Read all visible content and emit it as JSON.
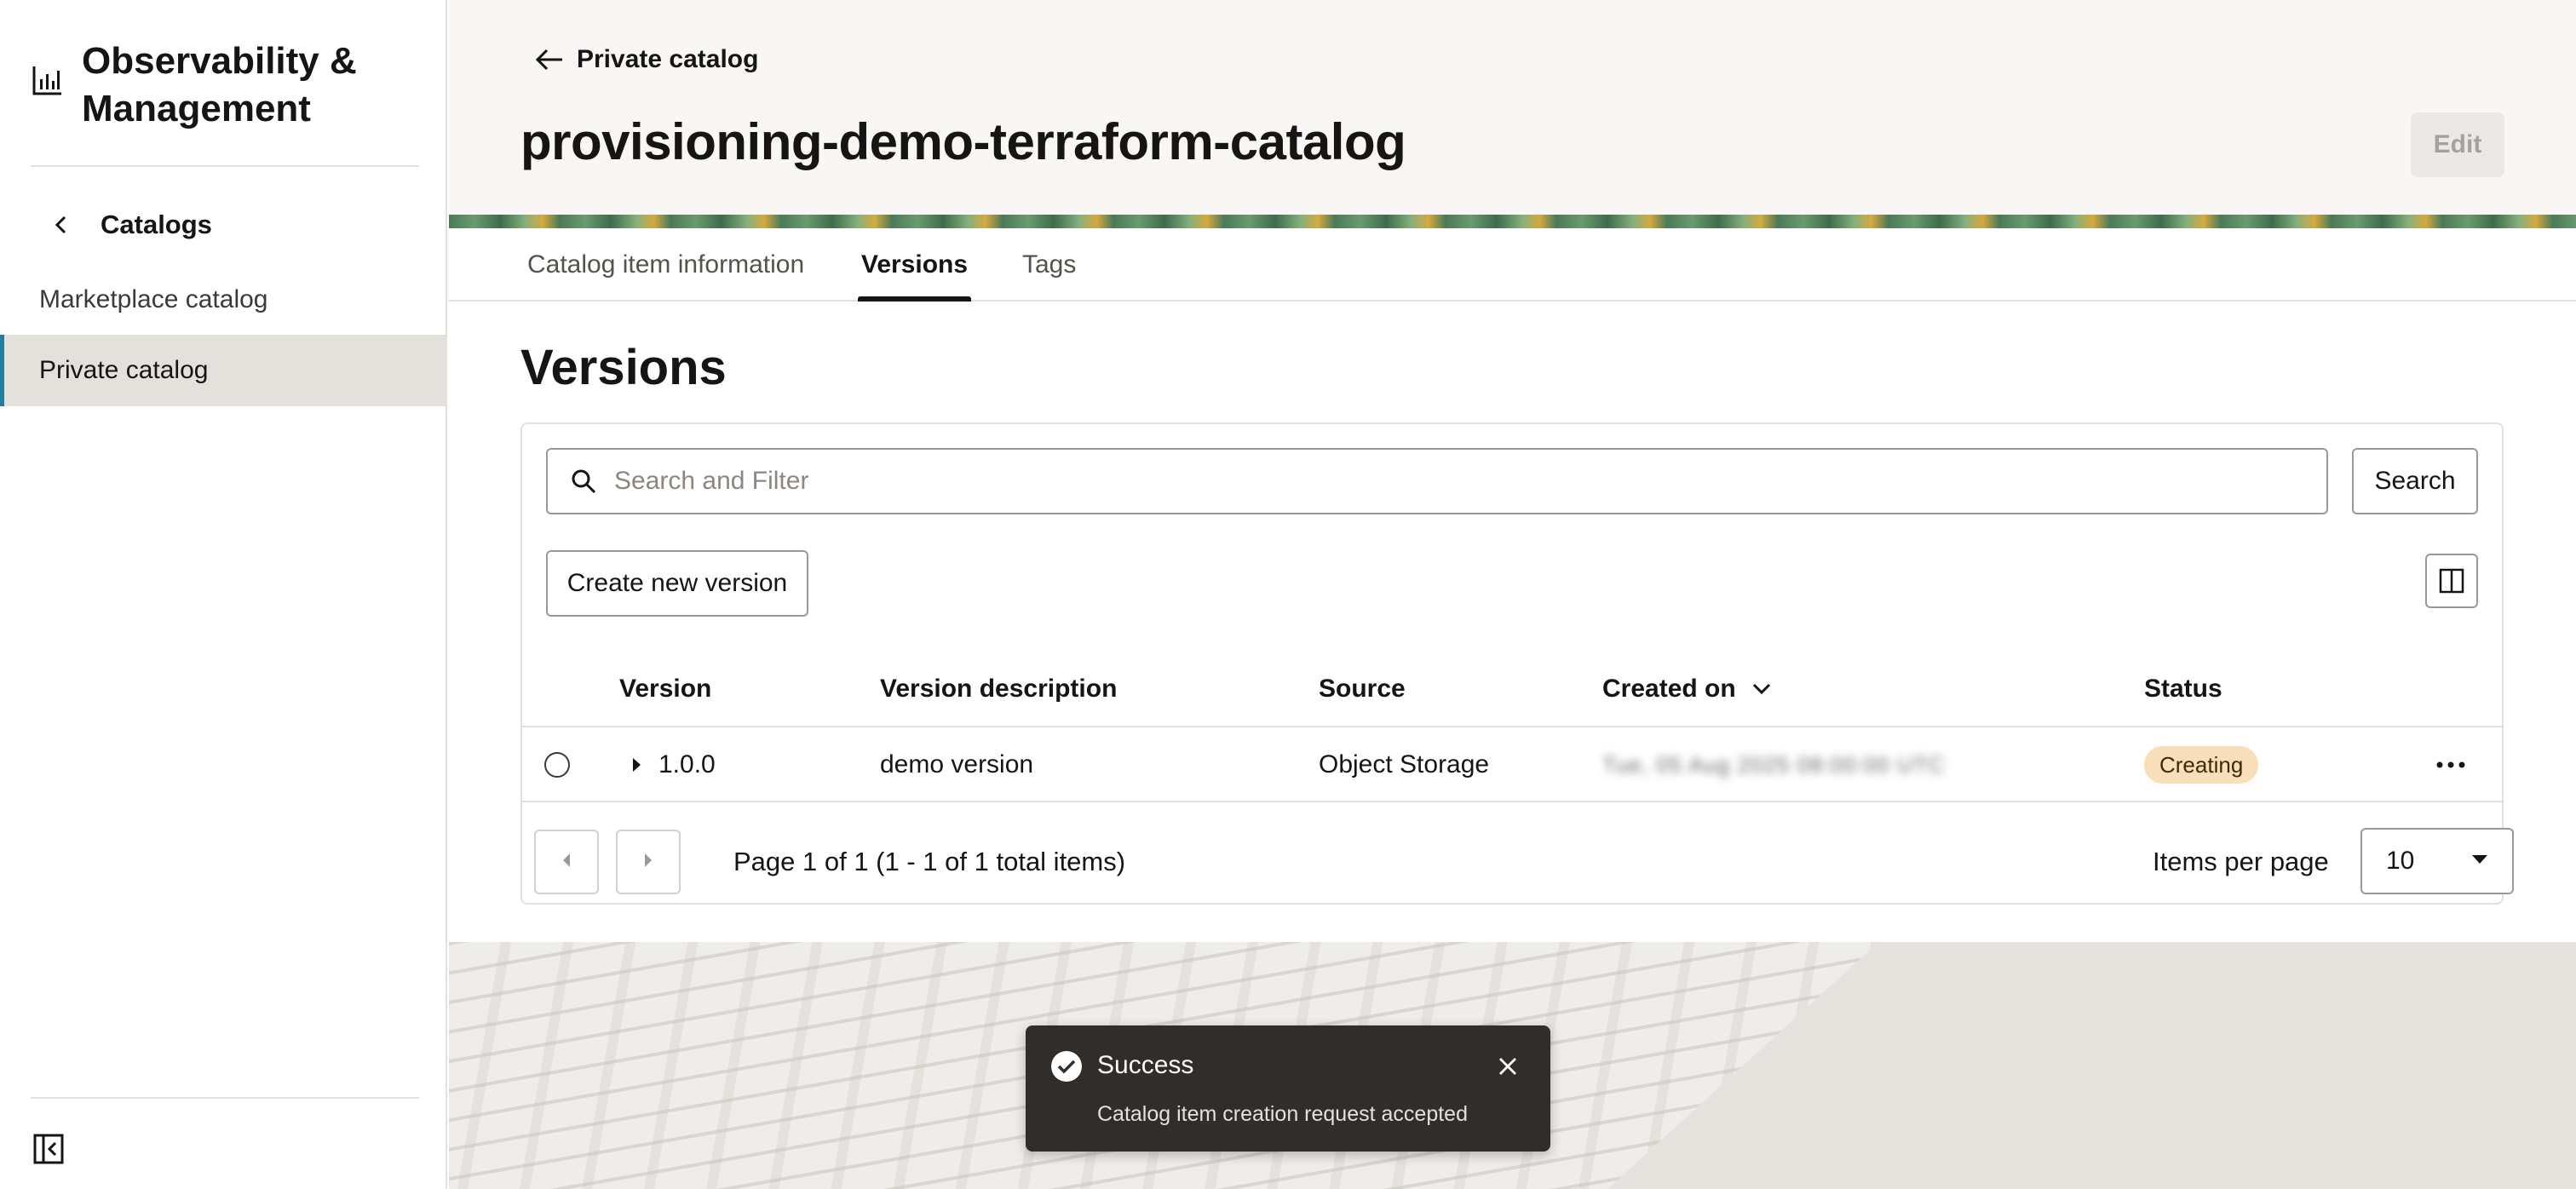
{
  "sidebar": {
    "app_title": "Observability & Management",
    "app_icon": "analytics-chart-icon",
    "back_label": "Catalogs",
    "items": [
      {
        "label": "Marketplace catalog",
        "selected": false
      },
      {
        "label": "Private catalog",
        "selected": true
      }
    ],
    "collapse_icon": "collapse-sidebar-icon"
  },
  "header": {
    "breadcrumb": "Private catalog",
    "title": "provisioning-demo-terraform-catalog",
    "edit_label": "Edit"
  },
  "tabs": [
    {
      "label": "Catalog item information",
      "active": false
    },
    {
      "label": "Versions",
      "active": true
    },
    {
      "label": "Tags",
      "active": false
    }
  ],
  "versions": {
    "title": "Versions",
    "search": {
      "placeholder": "Search and Filter",
      "value": "",
      "button_label": "Search"
    },
    "create_label": "Create new version",
    "columns": {
      "version": "Version",
      "description": "Version description",
      "source": "Source",
      "created_on": "Created on",
      "status": "Status"
    },
    "rows": [
      {
        "version": "1.0.0",
        "description": "demo version",
        "source": "Object Storage",
        "created_on": "Tue, 05 Aug 2025 08:00:00 UTC",
        "status": "Creating"
      }
    ],
    "pagination": {
      "page_info": "Page 1 of 1 (1 - 1 of 1 total items)",
      "items_per_page_label": "Items per page",
      "items_per_page": "10"
    }
  },
  "toast": {
    "title": "Success",
    "message": "Catalog item creation request accepted"
  },
  "colors": {
    "accent": "#227e9e",
    "status_creating_bg": "#f9dfb9",
    "toast_bg": "#312d2a"
  }
}
